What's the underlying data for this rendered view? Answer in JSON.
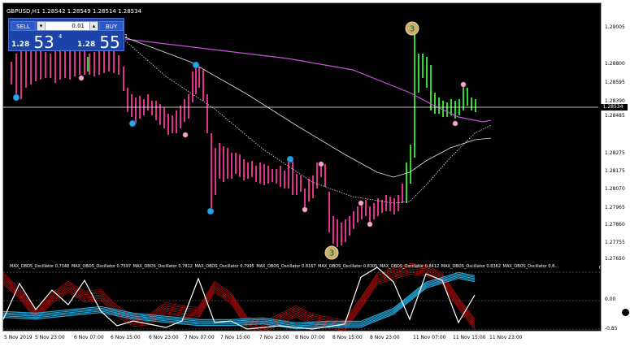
{
  "header": {
    "text": "GBPUSD,H1  1.28542 1.28549 1.28514 1.28534"
  },
  "trade_panel": {
    "sell_label": "SELL",
    "buy_label": "BUY",
    "lot_value": "0.01",
    "sell_quote": {
      "prefix": "1.28",
      "big": "53",
      "sup": "4"
    },
    "buy_quote": {
      "prefix": "1.28",
      "big": "55",
      "sup": "1"
    }
  },
  "price_axis": {
    "labels": [
      "1.29005",
      "1.28800",
      "1.28595",
      "1.28390",
      "1.28275",
      "1.28175",
      "1.28070",
      "1.27965",
      "1.27860",
      "1.27755",
      "1.27650"
    ],
    "current": "1.28534",
    "level_1": "1.28485"
  },
  "oscillator": {
    "labels": [
      "MAX_OBOS_Oscillator 0.7348",
      "MAX_OBOS_Oscillator 0.7597",
      "MAX_OBOS_Oscillator 0.7812",
      "MAX_OBOS_Oscillator 0.7995",
      "MAX_OBOS_Oscillator 0.8167",
      "MAX_OBOS_Oscillator 0.8305",
      "MAX_OBOS_Oscillator 0.8412",
      "MAX_OBOS_Oscillator 0.8362",
      "MAX_OBOS_Oscillator 0.8..."
    ],
    "scale_top": "0.85",
    "scale_mid": "0.00",
    "scale_bottom": "-0.85"
  },
  "time_axis": [
    "5 Nov 2019",
    "5 Nov 23:00",
    "6 Nov 07:00",
    "6 Nov 15:00",
    "6 Nov 23:00",
    "7 Nov 07:00",
    "7 Nov 15:00",
    "7 Nov 23:00",
    "8 Nov 07:00",
    "8 Nov 15:00",
    "8 Nov 23:00",
    "11 Nov 07:00",
    "11 Nov 15:00",
    "11 Nov 23:00"
  ],
  "markers": [
    {
      "text": "3",
      "kind": "big"
    },
    {
      "text": "3",
      "kind": "big"
    }
  ],
  "colors": {
    "bear": "#e0328c",
    "bull": "#2fdb2f",
    "ma_purple": "#c653d8",
    "ma_white": "#e6e6e6",
    "dot_blue": "#2aa3e6",
    "dot_pink": "#f0a8c8",
    "osc_red": "#d01010",
    "osc_blue": "#26b4e8",
    "big_marker": "#c9b06a"
  }
}
